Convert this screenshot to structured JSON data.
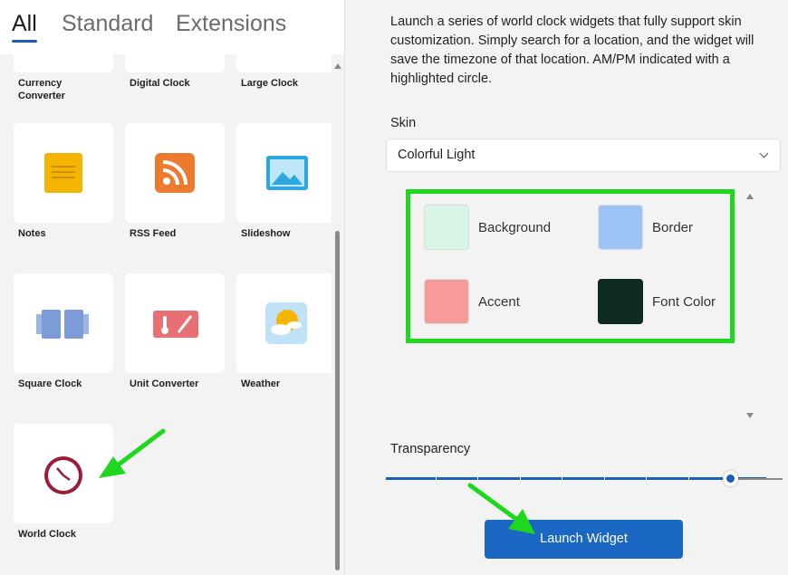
{
  "tabs": [
    {
      "label": "All",
      "active": true
    },
    {
      "label": "Standard",
      "active": false
    },
    {
      "label": "Extensions",
      "active": false
    }
  ],
  "tiles": [
    {
      "label": "Currency\nConverter",
      "icon": "currency-icon"
    },
    {
      "label": "Digital Clock",
      "icon": "digital-clock-icon"
    },
    {
      "label": "Large Clock",
      "icon": "large-clock-icon"
    },
    {
      "label": "Notes",
      "icon": "notes-icon",
      "color": "#f5b400"
    },
    {
      "label": "RSS Feed",
      "icon": "rss-icon",
      "color": "#ee7a2e"
    },
    {
      "label": "Slideshow",
      "icon": "slideshow-icon",
      "color": "#2ea7e0"
    },
    {
      "label": "Square Clock",
      "icon": "square-clock-icon",
      "color": "#7d9bd6"
    },
    {
      "label": "Unit Converter",
      "icon": "thermometer-icon",
      "color": "#e86f73"
    },
    {
      "label": "Weather",
      "icon": "weather-icon",
      "color": "#f5b400"
    },
    {
      "label": "World Clock",
      "icon": "world-clock-icon",
      "color": "#9b1c37"
    }
  ],
  "description": "Launch a series of world clock widgets that fully support skin customization. Simply search for a location, and the widget will save the timezone of that location. AM/PM indicated with a highlighted circle.",
  "skin": {
    "label": "Skin",
    "selected": "Colorful Light",
    "colors": [
      {
        "name": "Background",
        "hex": "#d8f5e6"
      },
      {
        "name": "Border",
        "hex": "#9ec3f7"
      },
      {
        "name": "Accent",
        "hex": "#f79a9a"
      },
      {
        "name": "Font Color",
        "hex": "#0f2a20"
      }
    ]
  },
  "transparency": {
    "label": "Transparency",
    "value": 0.9
  },
  "launch_button": "Launch Widget",
  "highlight_color": "#1fd71f"
}
